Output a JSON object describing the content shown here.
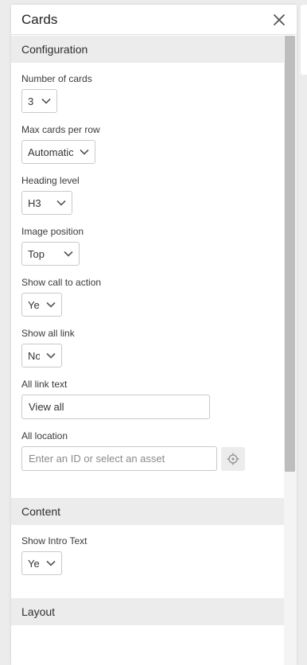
{
  "panel": {
    "title": "Cards",
    "close_icon": "close-icon"
  },
  "sections": {
    "configuration": {
      "title": "Configuration",
      "fields": {
        "number_of_cards": {
          "label": "Number of cards",
          "value": "3"
        },
        "max_cards_per_row": {
          "label": "Max cards per row",
          "value": "Automatic"
        },
        "heading_level": {
          "label": "Heading level",
          "value": "H3"
        },
        "image_position": {
          "label": "Image position",
          "value": "Top"
        },
        "show_call_to_action": {
          "label": "Show call to action",
          "value": "Yes"
        },
        "show_all_link": {
          "label": "Show all link",
          "value": "No"
        },
        "all_link_text": {
          "label": "All link text",
          "value": "View all"
        },
        "all_location": {
          "label": "All location",
          "placeholder": "Enter an ID or select an asset",
          "picker_icon": "crosshair-icon"
        }
      }
    },
    "content": {
      "title": "Content",
      "fields": {
        "show_intro_text": {
          "label": "Show Intro Text",
          "value": "Yes"
        }
      }
    },
    "layout": {
      "title": "Layout"
    }
  },
  "colors": {
    "section_header_bg": "#ececec",
    "border": "#c9c9c9",
    "scroll_thumb": "#bdbdbd"
  }
}
